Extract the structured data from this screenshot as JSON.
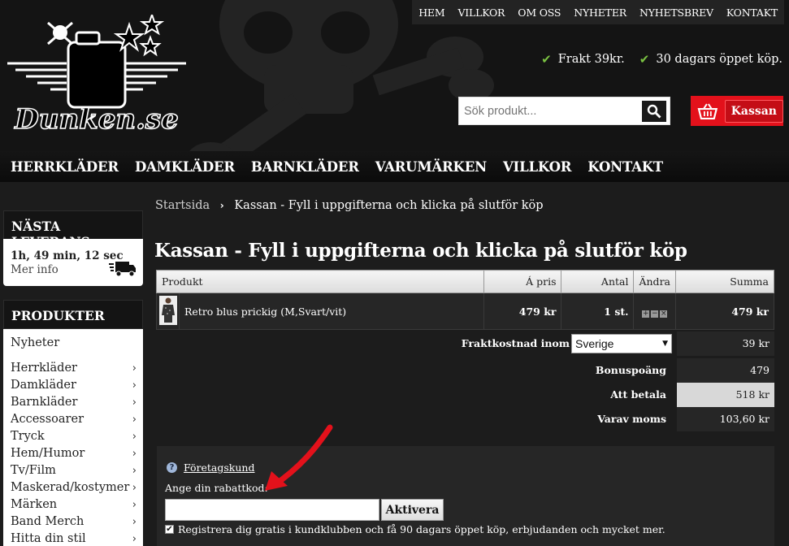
{
  "site": {
    "logo_text": "Dunken.se"
  },
  "top_nav": [
    "HEM",
    "VILLKOR",
    "OM OSS",
    "NYHETER",
    "NYHETSBREV",
    "KONTAKT"
  ],
  "usps": [
    "Frakt 39kr.",
    "30 dagars öppet köp."
  ],
  "search": {
    "placeholder": "Sök produkt..."
  },
  "cart": {
    "label": "Kassan"
  },
  "main_nav": [
    "HERRKLÄDER",
    "DAMKLÄDER",
    "BARNKLÄDER",
    "VARUMÄRKEN",
    "VILLKOR",
    "KONTAKT"
  ],
  "sidebar": {
    "delivery_title": "NÄSTA LEVERANS",
    "delivery_time": "1h, 49 min, 12 sec",
    "delivery_more": "Mer info",
    "products_title": "PRODUKTER",
    "categories": [
      "Nyheter",
      "Herrkläder",
      "Damkläder",
      "Barnkläder",
      "Accessoarer",
      "Tryck",
      "Hem/Humor",
      "Tv/Film",
      "Maskerad/kostymer",
      "Märken",
      "Band Merch",
      "Hitta din stil"
    ]
  },
  "breadcrumb": {
    "home": "Startsida",
    "current": "Kassan - Fyll i uppgifterna och klicka på slutför köp"
  },
  "page_title": "Kassan - Fyll i uppgifterna och klicka på slutför köp",
  "table": {
    "headers": {
      "product": "Produkt",
      "price": "Á pris",
      "qty": "Antal",
      "change": "Ändra",
      "sum": "Summa"
    },
    "rows": [
      {
        "name": "Retro blus prickig (M,Svart/vit)",
        "price": "479 kr",
        "qty": "1 st.",
        "sum": "479 kr"
      }
    ]
  },
  "summary": {
    "shipping_label": "Fraktkostnad inom",
    "shipping_country": "Sverige",
    "shipping_value": "39 kr",
    "bonus_label": "Bonuspoäng",
    "bonus_value": "479",
    "to_pay_label": "Att betala",
    "to_pay_value": "518 kr",
    "vat_label": "Varav moms",
    "vat_value": "103,60 kr"
  },
  "discount": {
    "corporate_link": "Företagskund",
    "code_label": "Ange din rabattkod:",
    "code_value": "",
    "activate_label": "Aktivera",
    "register_text": "Registrera dig gratis i kundklubben och få 90 dagars öppet köp, erbjudanden och mycket mer.",
    "register_checked": true
  },
  "colors": {
    "accent_red": "#e3111b",
    "check_green": "#7ac142"
  }
}
